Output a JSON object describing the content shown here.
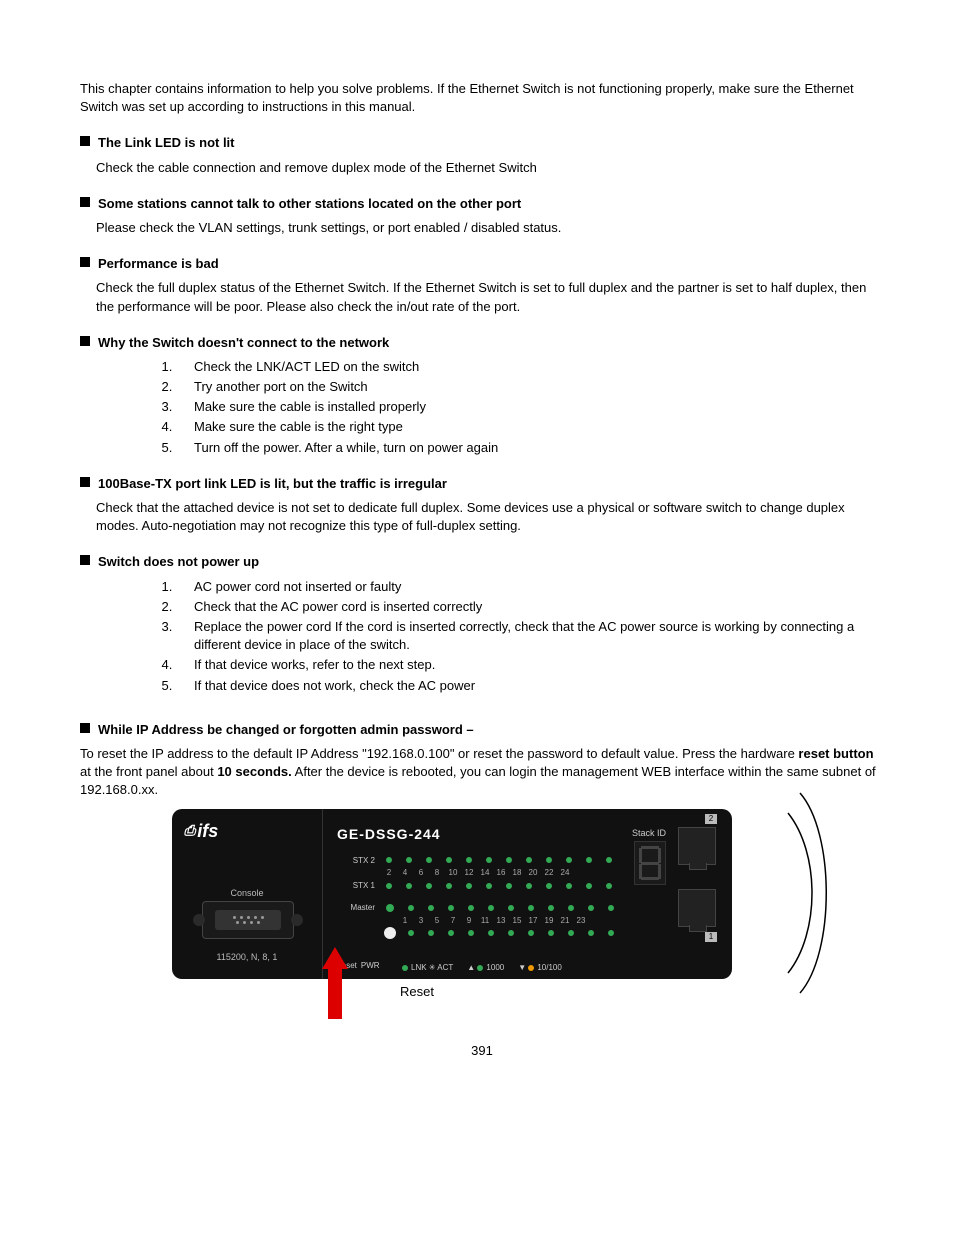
{
  "intro": "This chapter contains information to help you solve problems. If the Ethernet Switch is not functioning properly, make sure the Ethernet Switch was set up according to instructions in this manual.",
  "sections": [
    {
      "title": "The Link LED is not lit",
      "answer_simple": "Check the cable connection and remove duplex mode of the Ethernet Switch"
    },
    {
      "title": "Some stations cannot talk to other stations located on the other port",
      "answer_simple": "Please check the VLAN settings, trunk settings, or port enabled / disabled status."
    },
    {
      "title": "Performance is bad",
      "answer_simple": "Check the full duplex status of the Ethernet Switch.   If the Ethernet Switch is set to full duplex and the partner is set to half duplex, then the performance will be poor. Please also check the in/out rate of the port."
    },
    {
      "title": "Why the Switch doesn't connect to the network",
      "steps": [
        "Check the LNK/ACT LED on the switch",
        "Try another port on the Switch",
        "Make sure the cable is installed properly",
        "Make sure the cable is the right type",
        "Turn off the power. After a while, turn on power again"
      ]
    },
    {
      "title": "100Base-TX port link LED is lit, but the traffic is irregular",
      "answer_simple": "Check that the attached device is not set to dedicate full duplex. Some devices use a physical or software switch to change duplex modes. Auto-negotiation may not recognize this type of full-duplex setting."
    },
    {
      "title": "Switch does not power up",
      "steps": [
        "AC power cord not inserted or faulty",
        "Check that the AC power cord is inserted correctly",
        "Replace the power cord If the cord is inserted correctly, check that the AC power source is working by connecting a different device in place of the switch.",
        "If that device works, refer to the next step.",
        "If that device does not work, check the AC power"
      ]
    }
  ],
  "reset": {
    "title_prefix": "While IP Address be changed or forgotten admin password",
    "title_suffix": "–",
    "p1a": "To reset the IP address to the default IP Address \"192.168.0.100\" or reset the password to default value. Press the hardware ",
    "p1b": "reset button",
    "p1c": " at the front panel about ",
    "p1d": "10 seconds.",
    "p1e": " After the device is rebooted, you can login the management WEB interface within the same subnet of 192.168.0.xx."
  },
  "device": {
    "brand": "ifs",
    "model": "GE-DSSG-244",
    "console_label": "Console",
    "baud": "115200, N, 8, 1",
    "stack_label": "Stack ID",
    "row_stx2": "STX 2",
    "row_stx1": "STX 1",
    "row_master": "Master",
    "reset_label": "Reset",
    "pwr_label": "PWR",
    "legend_lnk": "LNK",
    "legend_act": "ACT",
    "legend_1000": "1000",
    "legend_10100": "10/100",
    "ports_top": [
      "2",
      "4",
      "6",
      "8",
      "10",
      "12",
      "14",
      "16",
      "18",
      "20",
      "22",
      "24"
    ],
    "ports_bottom": [
      "1",
      "3",
      "5",
      "7",
      "9",
      "11",
      "13",
      "15",
      "17",
      "19",
      "21",
      "23"
    ],
    "port_badge_top": "2",
    "port_badge_bottom": "1"
  },
  "reset_caption": "Reset",
  "page_number": "391"
}
